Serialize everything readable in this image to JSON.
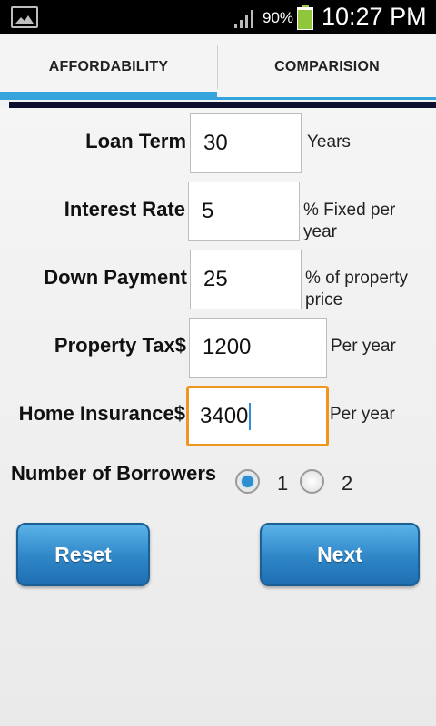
{
  "status_bar": {
    "battery_percent": "90%",
    "time": "10:27 PM",
    "icons": [
      "image-notification-icon",
      "signal-icon",
      "battery-icon"
    ]
  },
  "tabs": [
    {
      "label": "AFFORDABILITY",
      "selected": true
    },
    {
      "label": "COMPARISION",
      "selected": false
    }
  ],
  "form": {
    "loan_term": {
      "label": "Loan Term",
      "value": "30",
      "unit": "Years"
    },
    "interest_rate": {
      "label": "Interest Rate",
      "value": "5",
      "unit_line1": "% Fixed per",
      "unit_line2": "year"
    },
    "down_payment": {
      "label": "Down Payment",
      "value": "25",
      "unit_line1": "% of property",
      "unit_line2": "price"
    },
    "property_tax": {
      "label": "Property Tax$",
      "value": "1200",
      "unit": "Per year"
    },
    "home_insurance": {
      "label": "Home Insurance$",
      "value": "3400",
      "unit": "Per year"
    },
    "borrowers": {
      "label": "Number of Borrowers",
      "options": [
        "1",
        "2"
      ],
      "selected": "1"
    }
  },
  "buttons": {
    "reset": "Reset",
    "next": "Next"
  },
  "colors": {
    "accent": "#35a3dc",
    "focus": "#f0961c",
    "button_top": "#5bb3e8",
    "button_bottom": "#1e6fb1"
  }
}
